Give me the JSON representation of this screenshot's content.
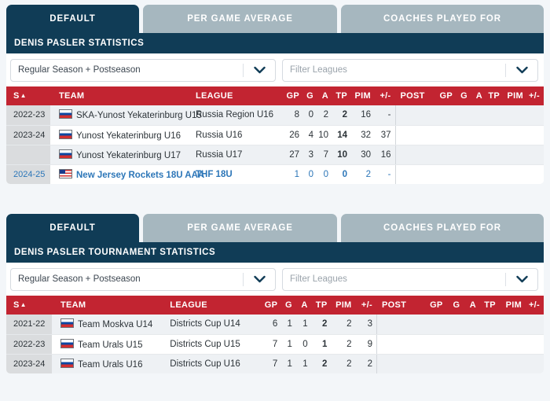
{
  "colors": {
    "navy": "#103c56",
    "tab_inactive": "#a6b7bf",
    "header_red": "#c22431",
    "link_blue": "#2c76b8",
    "page_bg": "#f3f6f9",
    "season_cell_bg": "#dadcde"
  },
  "panels": [
    {
      "tabs": [
        {
          "label": "DEFAULT",
          "active": true
        },
        {
          "label": "PER GAME AVERAGE",
          "active": false
        },
        {
          "label": "COACHES PLAYED FOR",
          "active": false
        }
      ],
      "title": "DENIS PASLER STATISTICS",
      "filters": {
        "season_select_value": "Regular Season + Postseason",
        "league_filter_placeholder": "Filter Leagues",
        "chevron_icon": "chevron-down-icon"
      },
      "table": {
        "columns": {
          "season": "S",
          "season_sort_indicator": "▲",
          "team": "TEAM",
          "league": "LEAGUE",
          "gp": "GP",
          "g": "G",
          "a": "A",
          "tp": "TP",
          "pim": "PIM",
          "plusminus": "+/-",
          "post": "POST",
          "post_gp": "GP",
          "post_g": "G",
          "post_a": "A",
          "post_tp": "TP",
          "post_pim": "PIM",
          "post_plusminus": "+/-"
        },
        "rows": [
          {
            "season": "2022-23",
            "flag": "flag-russia",
            "team": "SKA-Yunost Yekaterinburg U15",
            "league": "Russia Region U16",
            "gp": "8",
            "g": "0",
            "a": "2",
            "tp": "2",
            "pim": "16",
            "plusminus": "-",
            "post_gp": "",
            "post_g": "",
            "post_a": "",
            "post_tp": "",
            "post_pim": "",
            "post_plusminus": "",
            "link": false
          },
          {
            "season": "2023-24",
            "flag": "flag-russia",
            "team": "Yunost Yekaterinburg U16",
            "league": "Russia U16",
            "gp": "26",
            "g": "4",
            "a": "10",
            "tp": "14",
            "pim": "32",
            "plusminus": "37",
            "post_gp": "",
            "post_g": "",
            "post_a": "",
            "post_tp": "",
            "post_pim": "",
            "post_plusminus": "",
            "link": false
          },
          {
            "season": "",
            "flag": "flag-russia",
            "team": "Yunost Yekaterinburg U17",
            "league": "Russia U17",
            "gp": "27",
            "g": "3",
            "a": "7",
            "tp": "10",
            "pim": "30",
            "plusminus": "16",
            "post_gp": "",
            "post_g": "",
            "post_a": "",
            "post_tp": "",
            "post_pim": "",
            "post_plusminus": "",
            "link": false
          },
          {
            "season": "2024-25",
            "flag": "flag-usa",
            "team": "New Jersey Rockets 18U AAA",
            "league": "THF 18U",
            "gp": "1",
            "g": "0",
            "a": "0",
            "tp": "0",
            "pim": "2",
            "plusminus": "-",
            "post_gp": "",
            "post_g": "",
            "post_a": "",
            "post_tp": "",
            "post_pim": "",
            "post_plusminus": "",
            "link": true
          }
        ]
      }
    },
    {
      "tabs": [
        {
          "label": "DEFAULT",
          "active": true
        },
        {
          "label": "PER GAME AVERAGE",
          "active": false
        },
        {
          "label": "COACHES PLAYED FOR",
          "active": false
        }
      ],
      "title": "DENIS PASLER TOURNAMENT STATISTICS",
      "filters": {
        "season_select_value": "Regular Season + Postseason",
        "league_filter_placeholder": "Filter Leagues",
        "chevron_icon": "chevron-down-icon"
      },
      "table": {
        "columns": {
          "season": "S",
          "season_sort_indicator": "▲",
          "team": "TEAM",
          "league": "LEAGUE",
          "gp": "GP",
          "g": "G",
          "a": "A",
          "tp": "TP",
          "pim": "PIM",
          "plusminus": "+/-",
          "post": "POST",
          "post_gp": "GP",
          "post_g": "G",
          "post_a": "A",
          "post_tp": "TP",
          "post_pim": "PIM",
          "post_plusminus": "+/-"
        },
        "rows": [
          {
            "season": "2021-22",
            "flag": "flag-russia",
            "team": "Team Moskva U14",
            "league": "Districts Cup U14",
            "gp": "6",
            "g": "1",
            "a": "1",
            "tp": "2",
            "pim": "2",
            "plusminus": "3",
            "post_gp": "",
            "post_g": "",
            "post_a": "",
            "post_tp": "",
            "post_pim": "",
            "post_plusminus": "",
            "link": false
          },
          {
            "season": "2022-23",
            "flag": "flag-russia",
            "team": "Team Urals U15",
            "league": "Districts Cup U15",
            "gp": "7",
            "g": "1",
            "a": "0",
            "tp": "1",
            "pim": "2",
            "plusminus": "9",
            "post_gp": "",
            "post_g": "",
            "post_a": "",
            "post_tp": "",
            "post_pim": "",
            "post_plusminus": "",
            "link": false
          },
          {
            "season": "2023-24",
            "flag": "flag-russia",
            "team": "Team Urals U16",
            "league": "Districts Cup U16",
            "gp": "7",
            "g": "1",
            "a": "1",
            "tp": "2",
            "pim": "2",
            "plusminus": "2",
            "post_gp": "",
            "post_g": "",
            "post_a": "",
            "post_tp": "",
            "post_pim": "",
            "post_plusminus": "",
            "link": false
          }
        ]
      }
    }
  ]
}
